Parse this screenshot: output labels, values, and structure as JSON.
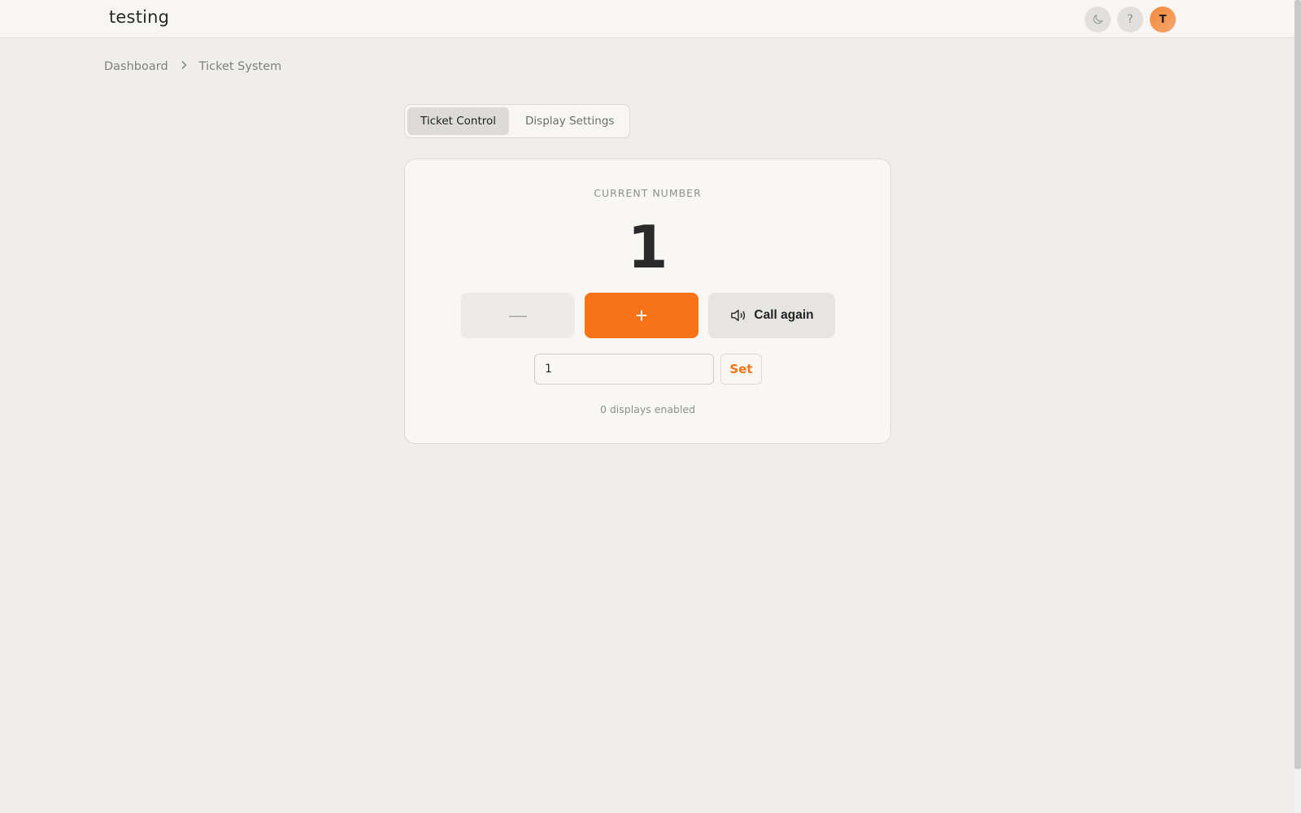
{
  "header": {
    "app_title": "testing",
    "theme_toggle_icon": "moon-icon",
    "help_label": "?",
    "avatar_initial": "T"
  },
  "breadcrumb": {
    "items": [
      "Dashboard",
      "Ticket System"
    ],
    "separator": "›"
  },
  "tabs": [
    {
      "label": "Ticket Control",
      "active": true
    },
    {
      "label": "Display Settings",
      "active": false
    }
  ],
  "ticket": {
    "section_label": "CURRENT NUMBER",
    "current_number": "1",
    "decrement_label": "—",
    "increment_label": "+",
    "call_again_label": "Call again",
    "input_value": "1",
    "set_label": "Set",
    "displays_status": "0 displays enabled"
  },
  "colors": {
    "accent": "#f87318",
    "background": "#efeeea",
    "card": "#f8f7f4"
  }
}
